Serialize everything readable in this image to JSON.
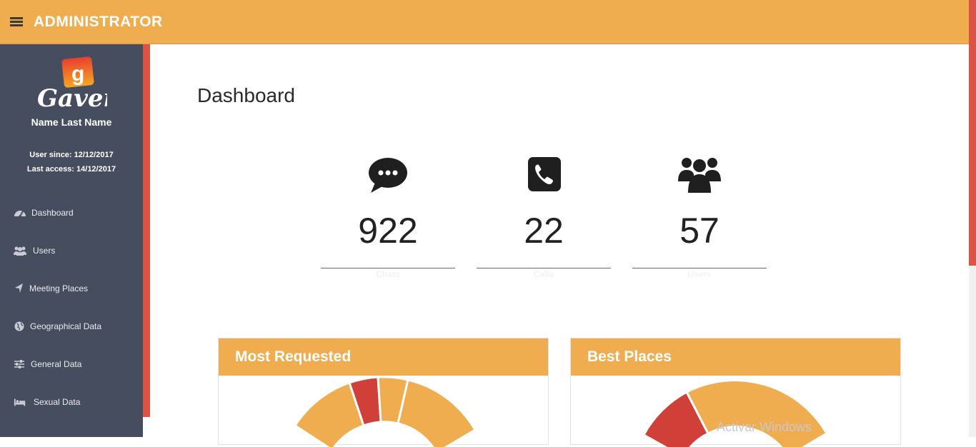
{
  "header": {
    "title": "ADMINISTRATOR",
    "menu_icon": "hamburger-icon",
    "color": "#efad4f"
  },
  "sidebar": {
    "logo_text": "Gaver",
    "logo_letter": "g",
    "profile_name": "Name Last Name",
    "user_since": "User since: 12/12/2017",
    "last_access": "Last access: 14/12/2017",
    "items": [
      {
        "label": "Dashboard",
        "icon": "dashboard-icon"
      },
      {
        "label": "Users",
        "icon": "users-icon"
      },
      {
        "label": "Meeting Places",
        "icon": "location-arrow-icon"
      },
      {
        "label": "Geographical Data",
        "icon": "globe-icon"
      },
      {
        "label": "General Data",
        "icon": "sliders-icon"
      },
      {
        "label": "Sexual Data",
        "icon": "bed-icon"
      }
    ],
    "color": "#464d5f",
    "accent": "#dc5345"
  },
  "main": {
    "title": "Dashboard",
    "stats": [
      {
        "value": "922",
        "caption": "Chats",
        "icon": "chat-bubble-icon"
      },
      {
        "value": "22",
        "caption": "Calls",
        "icon": "phone-icon"
      },
      {
        "value": "57",
        "caption": "Users",
        "icon": "users-icon"
      }
    ],
    "panels": [
      {
        "title": "Most Requested"
      },
      {
        "title": "Best Places"
      }
    ]
  },
  "watermark": "Activar Windows"
}
